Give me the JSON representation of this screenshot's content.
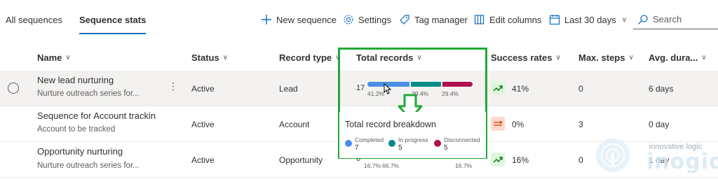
{
  "tabs": [
    {
      "label": "All sequences"
    },
    {
      "label": "Sequence stats"
    }
  ],
  "toolbar": {
    "new_sequence": "New sequence",
    "settings": "Settings",
    "tag_manager": "Tag manager",
    "edit_columns": "Edit columns",
    "date_range": "Last 30 days",
    "search_placeholder": "Search"
  },
  "columns": {
    "name": "Name",
    "status": "Status",
    "record_type": "Record type",
    "total_records": "Total records",
    "success_rates": "Success rates",
    "max_steps": "Max. steps",
    "avg_duration": "Avg. dura..."
  },
  "rows": [
    {
      "name": "New lead nurturing",
      "description": "Nurture outreach series for...",
      "status": "Active",
      "record_type": "Lead",
      "total_records": "17",
      "pct_completed": "41.2%",
      "pct_in_progress": "29.4%",
      "pct_disconnected": "29.4%",
      "success_rate": "41%",
      "max_steps": "0",
      "avg_duration": "6 days"
    },
    {
      "name": "Sequence for Account trackin",
      "description": "Account to be tracked",
      "status": "Active",
      "record_type": "Account",
      "success_rate": "0%",
      "max_steps": "3",
      "avg_duration": "0 day"
    },
    {
      "name": "Opportunity nurturing",
      "description": "Nurture outreach series for...",
      "status": "Active",
      "record_type": "Opportunity",
      "total_records": "6",
      "pct_completed": "16.7%",
      "pct_in_progress": "66.7%",
      "pct_disconnected": "16.7%",
      "success_rate": "16%",
      "max_steps": "0",
      "avg_duration": "1 day"
    }
  ],
  "breakdown": {
    "title": "Total record breakdown",
    "completed_label": "Completed",
    "completed_count": "7",
    "in_progress_label": "In progress",
    "in_progress_count": "5",
    "disconnected_label": "Disconnected",
    "disconnected_count": "5",
    "completed_share": 0.412,
    "in_progress_share": 0.294,
    "disconnected_share": 0.294
  },
  "colors": {
    "completed": "#4a8fe7",
    "in_progress": "#0b8a8a",
    "disconnected": "#b0124e",
    "highlight": "#22a838",
    "up_trend": "#dff6dd",
    "flat_trend": "#fed9cc"
  },
  "watermark": {
    "tagline": "innovative logic",
    "brand": "inogic"
  }
}
